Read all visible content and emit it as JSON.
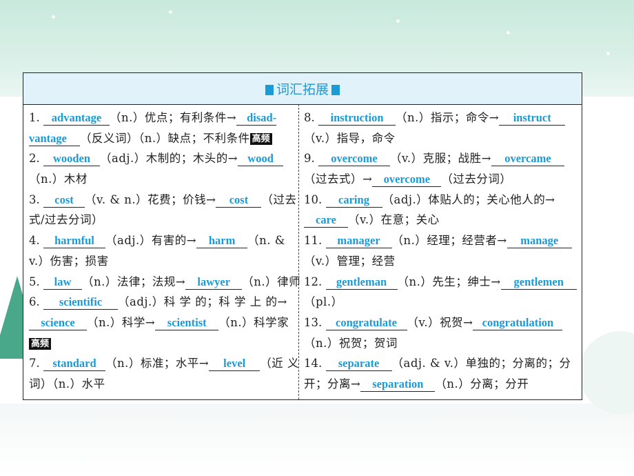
{
  "section": {
    "title": "词汇拓展"
  },
  "badge": "高频",
  "left": {
    "i1": {
      "num": "1.",
      "a1": "advantage",
      "t1": "（n.）优点；有利条件→",
      "a1b": "disad-",
      "a1c": "vantage",
      "t2": "（反义词）（n.）缺点；不利条件"
    },
    "i2": {
      "num": "2.",
      "a1": "wooden",
      "t1": "（adj.）木制的；木头的→",
      "a2": "wood",
      "t2": "（n.）木材"
    },
    "i3": {
      "num": "3.",
      "a1": "cost",
      "t1": "（v. & n.）花费；价钱→",
      "a2": "cost",
      "t2": "（过去",
      "t3": "式/过去分词）"
    },
    "i4": {
      "num": "4.",
      "a1": "harmful",
      "t1": "（adj.）有害的→",
      "a2": "harm",
      "t2": "（n. &",
      "t3": "v.）伤害；损害"
    },
    "i5": {
      "num": "5.",
      "a1": "law",
      "t1": "（n.）法律；法规→",
      "a2": "lawyer",
      "t2": "（n.）律师"
    },
    "i6": {
      "num": "6.",
      "a1": "scientific",
      "t1": "（adj.）科 学 的；科 学 上 的→",
      "a2": "science",
      "t2": "（n.）科学→",
      "a3": "scientist",
      "t3": "（n.）科学家"
    },
    "i7": {
      "num": "7.",
      "a1": "standard",
      "t1": "（n.）标准；水平→",
      "a2": "level",
      "t2": "（近 义",
      "t3": "词）（n.）水平"
    }
  },
  "right": {
    "i8": {
      "num": "8.",
      "a1": "instruction",
      "t1": "（n.）指示；命令→",
      "a2": "instruct",
      "t2": "（v.）指导，命令"
    },
    "i9": {
      "num": "9.",
      "a1": "overcome",
      "t1": "（v.）克服；战胜→",
      "a2": "overcame",
      "t2": "（过去式）→",
      "a3": "overcome",
      "t3": "（过去分词）"
    },
    "i10": {
      "num": "10.",
      "a1": "caring",
      "t1": "（adj.）体贴人的；关心他人的→",
      "a2": "care",
      "t2": "（v.）在意；关心"
    },
    "i11": {
      "num": "11.",
      "a1": "manager",
      "t1": "（n.）经理；经营者→",
      "a2": "manage",
      "t2": "（v.）管理；经营"
    },
    "i12": {
      "num": "12.",
      "a1": "gentleman",
      "t1": "（n.）先生；绅士→",
      "a2": "gentlemen",
      "t2": "（pl.）"
    },
    "i13": {
      "num": "13.",
      "a1": "congratulate",
      "t1": "（v.）祝贺→",
      "a2": "congratulation",
      "t2": "（n.）祝贺；贺词"
    },
    "i14": {
      "num": "14.",
      "a1": "separate",
      "t1": "（adj. & v.）单独的；分离的；分",
      "t2": "开；分离→",
      "a2": "separation",
      "t3": "（n.）分离；分开"
    }
  },
  "colors": {
    "accent": "#1a9ad6",
    "header_bg": "#e2f2fb",
    "border": "#222222"
  }
}
